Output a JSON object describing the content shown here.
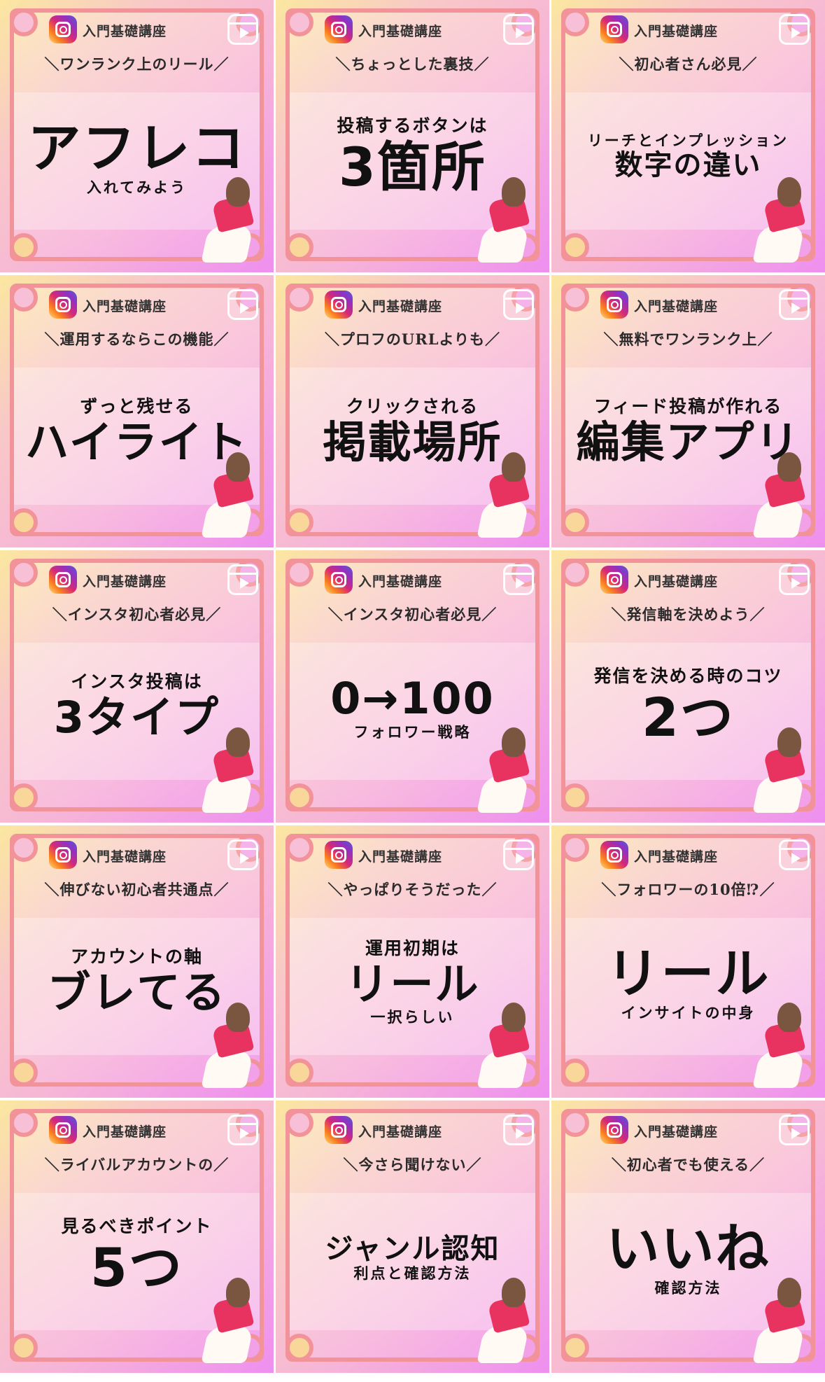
{
  "tiles": [
    {
      "course": "入門基礎講座",
      "tag": "＼ワンランク上のリール／",
      "lines": [
        {
          "text": "アフレコ",
          "size": "xl"
        },
        {
          "text": "入れてみよう",
          "size": "xs"
        }
      ]
    },
    {
      "course": "入門基礎講座",
      "tag": "＼ちょっとした裏技／",
      "lines": [
        {
          "text": "投稿するボタンは",
          "size": "s"
        },
        {
          "text": "3箇所",
          "size": "xl"
        }
      ]
    },
    {
      "course": "入門基礎講座",
      "tag": "＼初心者さん必見／",
      "lines": [
        {
          "text": "リーチとインプレッション",
          "size": "xs"
        },
        {
          "text": "数字の違い",
          "size": "m"
        }
      ]
    },
    {
      "course": "入門基礎講座",
      "tag": "＼運用するならこの機能／",
      "lines": [
        {
          "text": "ずっと残せる",
          "size": "s"
        },
        {
          "text": "ハイライト",
          "size": "l"
        }
      ]
    },
    {
      "course": "入門基礎講座",
      "tag": "＼プロフのURLよりも／",
      "lines": [
        {
          "text": "クリックされる",
          "size": "s"
        },
        {
          "text": "掲載場所",
          "size": "l"
        }
      ]
    },
    {
      "course": "入門基礎講座",
      "tag": "＼無料でワンランク上／",
      "lines": [
        {
          "text": "フィード投稿が作れる",
          "size": "s"
        },
        {
          "text": "編集アプリ",
          "size": "l"
        }
      ]
    },
    {
      "course": "入門基礎講座",
      "tag": "＼インスタ初心者必見／",
      "lines": [
        {
          "text": "インスタ投稿は",
          "size": "s"
        },
        {
          "text": "3タイプ",
          "size": "l"
        }
      ]
    },
    {
      "course": "入門基礎講座",
      "tag": "＼インスタ初心者必見／",
      "lines": [
        {
          "text": "0→100",
          "size": "l"
        },
        {
          "text": "フォロワー戦略",
          "size": "xs"
        }
      ]
    },
    {
      "course": "入門基礎講座",
      "tag": "＼発信軸を決めよう／",
      "lines": [
        {
          "text": "発信を決める時のコツ",
          "size": "s"
        },
        {
          "text": "2つ",
          "size": "xl"
        }
      ]
    },
    {
      "course": "入門基礎講座",
      "tag": "＼伸びない初心者共通点／",
      "lines": [
        {
          "text": "アカウントの軸",
          "size": "s"
        },
        {
          "text": "ブレてる",
          "size": "l"
        }
      ]
    },
    {
      "course": "入門基礎講座",
      "tag": "＼やっぱりそうだった／",
      "lines": [
        {
          "text": "運用初期は",
          "size": "s"
        },
        {
          "text": "リール",
          "size": "l"
        },
        {
          "text": "一択らしい",
          "size": "xs"
        }
      ]
    },
    {
      "course": "入門基礎講座",
      "tag": "＼フォロワーの10倍⁉︎／",
      "lines": [
        {
          "text": "リール",
          "size": "xl"
        },
        {
          "text": "インサイトの中身",
          "size": "xs"
        }
      ]
    },
    {
      "course": "入門基礎講座",
      "tag": "＼ライバルアカウントの／",
      "lines": [
        {
          "text": "見るべきポイント",
          "size": "s"
        },
        {
          "text": "5つ",
          "size": "xl"
        }
      ]
    },
    {
      "course": "入門基礎講座",
      "tag": "＼今さら聞けない／",
      "lines": [
        {
          "text": "ジャンル認知",
          "size": "m"
        },
        {
          "text": "利点と確認方法",
          "size": "xs"
        }
      ]
    },
    {
      "course": "入門基礎講座",
      "tag": "＼初心者でも使える／",
      "lines": [
        {
          "text": "いいね",
          "size": "xl"
        },
        {
          "text": "確認方法",
          "size": "xs"
        }
      ]
    }
  ],
  "icons": {
    "brand": "instagram-icon",
    "reel": "reels-icon"
  }
}
